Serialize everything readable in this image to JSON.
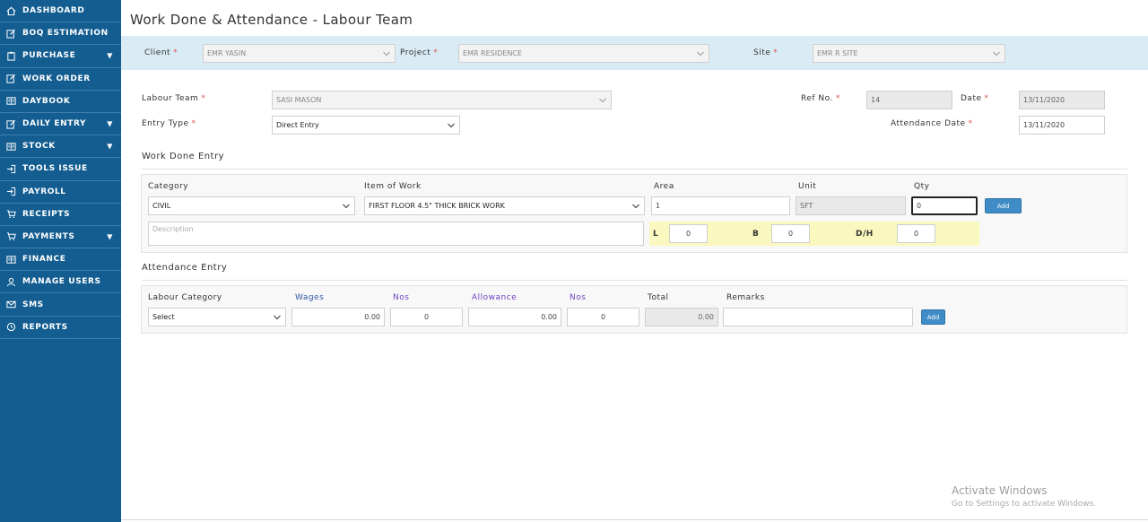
{
  "sidebar": {
    "items": [
      {
        "label": "DASHBOARD",
        "icon": "home-icon",
        "caret": false
      },
      {
        "label": "BOQ ESTIMATION",
        "icon": "edit-icon",
        "caret": false
      },
      {
        "label": "PURCHASE",
        "icon": "clipboard-icon",
        "caret": true
      },
      {
        "label": "WORK ORDER",
        "icon": "edit-icon",
        "caret": false
      },
      {
        "label": "DAYBOOK",
        "icon": "book-icon",
        "caret": false
      },
      {
        "label": "DAILY ENTRY",
        "icon": "edit-icon",
        "caret": true
      },
      {
        "label": "STOCK",
        "icon": "book-icon",
        "caret": true
      },
      {
        "label": "TOOLS ISSUE",
        "icon": "sign-in-icon",
        "caret": false
      },
      {
        "label": "PAYROLL",
        "icon": "sign-in-icon",
        "caret": false
      },
      {
        "label": "RECEIPTS",
        "icon": "cart-icon",
        "caret": false
      },
      {
        "label": "PAYMENTS",
        "icon": "cart-icon",
        "caret": true
      },
      {
        "label": "FINANCE",
        "icon": "book-icon",
        "caret": false
      },
      {
        "label": "MANAGE USERS",
        "icon": "user-icon",
        "caret": false
      },
      {
        "label": "SMS",
        "icon": "envelope-icon",
        "caret": false
      },
      {
        "label": "REPORTS",
        "icon": "history-icon",
        "caret": false
      }
    ],
    "caret_glyph": "▼"
  },
  "page": {
    "title": "Work Done & Attendance - Labour Team"
  },
  "header": {
    "client_label": "Client",
    "client_value": "EMR YASIN",
    "project_label": "Project",
    "project_value": "EMR RESIDENCE",
    "site_label": "Site",
    "site_value": "EMR R SITE",
    "required_mark": "*"
  },
  "form": {
    "labour_team_label": "Labour Team",
    "labour_team_value": "SASI MASON",
    "entry_type_label": "Entry Type",
    "entry_type_value": "Direct Entry",
    "ref_no_label": "Ref No.",
    "ref_no_value": "14",
    "date_label": "Date",
    "date_value": "13/11/2020",
    "attendance_date_label": "Attendance Date",
    "attendance_date_value": "13/11/2020"
  },
  "work_done": {
    "section_title": "Work Done Entry",
    "category_label": "Category",
    "category_value": "CIVIL",
    "item_label": "Item of Work",
    "item_value": "FIRST FLOOR 4.5\" THICK BRICK WORK",
    "area_label": "Area",
    "area_value": "1",
    "unit_label": "Unit",
    "unit_value": "SFT",
    "qty_label": "Qty",
    "qty_value": "0",
    "add_label": "Add",
    "description_placeholder": "Description",
    "l_label": "L",
    "l_value": "0",
    "b_label": "B",
    "b_value": "0",
    "dh_label": "D/H",
    "dh_value": "0"
  },
  "attendance": {
    "section_title": "Attendance Entry",
    "labour_category_label": "Labour Category",
    "labour_category_value": "Select",
    "wages_label": "Wages",
    "wages_value": "0.00",
    "nos1_label": "Nos",
    "nos1_value": "0",
    "allowance_label": "Allowance",
    "allowance_value": "0.00",
    "nos2_label": "Nos",
    "nos2_value": "0",
    "total_label": "Total",
    "total_value": "0.00",
    "remarks_label": "Remarks",
    "remarks_value": "",
    "add_label": "Add"
  },
  "watermark": {
    "line1": "Activate Windows",
    "line2": "Go to Settings to activate Windows."
  },
  "colors": {
    "sidebar": "#135d91",
    "header_bar": "#d9ecf5",
    "button": "#3f8cc6",
    "highlight": "#fbf8bf",
    "required": "#d9534f"
  }
}
